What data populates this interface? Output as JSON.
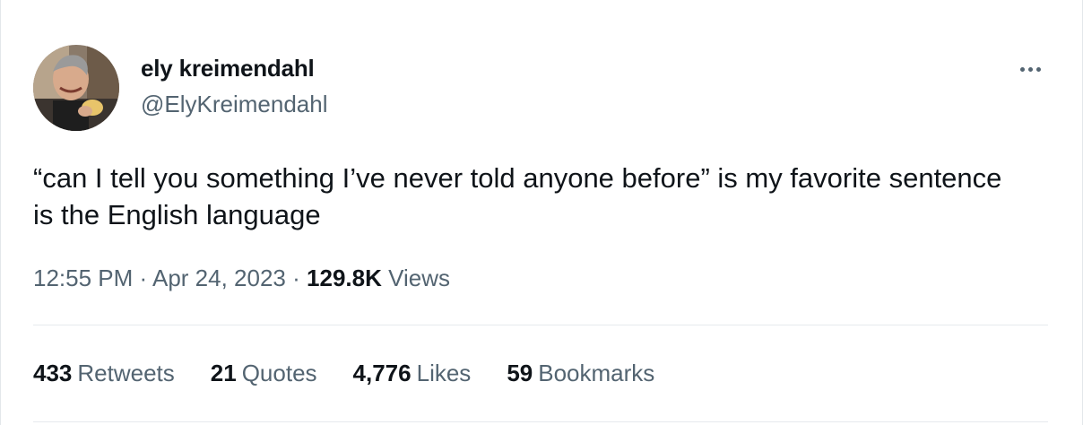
{
  "author": {
    "name": "ely kreimendahl",
    "handle": "@ElyKreimendahl"
  },
  "tweet": {
    "text": "“can I tell you something I’ve never told anyone before” is my favorite sentence is the English language",
    "time": "12:55 PM",
    "date": "Apr 24, 2023",
    "views_count": "129.8K",
    "views_label": "Views",
    "separator": "·"
  },
  "stats": {
    "retweets": {
      "count": "433",
      "label": "Retweets"
    },
    "quotes": {
      "count": "21",
      "label": "Quotes"
    },
    "likes": {
      "count": "4,776",
      "label": "Likes"
    },
    "bookmarks": {
      "count": "59",
      "label": "Bookmarks"
    }
  },
  "icons": {
    "more": "more-horizontal-icon"
  },
  "colors": {
    "text_primary": "#0f1419",
    "text_secondary": "#536471",
    "divider": "#e6eaee"
  }
}
